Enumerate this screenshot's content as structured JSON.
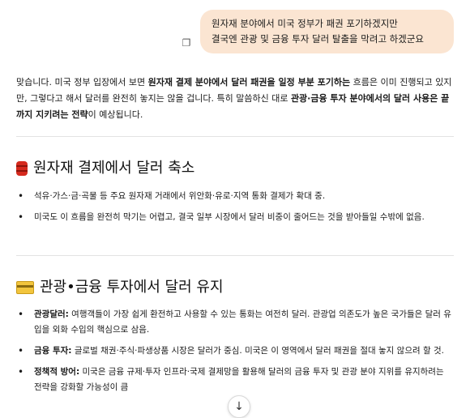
{
  "user_message": {
    "line1": "원자재 분야에서 미국 정부가 패권 포기하겠지만",
    "line2": "결국엔 관광 및 금융 투자 달러 탈출을 막려고 하겠군요"
  },
  "icons": {
    "copy": "copy-icon",
    "section1": "oil-barrel-icon",
    "section2": "credit-card-icon",
    "scroll": "arrow-down-icon"
  },
  "answer": {
    "intro": {
      "p1": "맞습니다. 미국 정부 입장에서 보면 ",
      "b1": "원자재 결제 분야에서 달러 패권을 일정 부분 포기하는",
      "p2": " 흐름은 이미 진행되고 있지만, 그렇다고 해서 달러를 완전히 놓지는 않을 겁니다. 특히 말씀하신 대로 ",
      "b2": "관광·금융 투자 분야에서의 달러 사용은 끝까지 지키려는 전략",
      "p3": "이 예상됩니다."
    },
    "section1": {
      "title": "원자재 결제에서 달러 축소",
      "bullets": [
        "석유·가스·금·곡물 등 주요 원자재 거래에서 위안화·유로·지역 통화 결제가 확대 중.",
        "미국도 이 흐름을 완전히 막기는 어렵고, 결국 일부 시장에서 달러 비중이 줄어드는 것을 받아들일 수밖에 없음."
      ]
    },
    "section2": {
      "title": "관광•금융 투자에서 달러 유지",
      "bullets": [
        {
          "label": "관광달러:",
          "text": " 여행객들이 가장 쉽게 환전하고 사용할 수 있는 통화는 여전히 달러. 관광업 의존도가 높은 국가들은 달러 유입을 외화 수입의 핵심으로 삼음."
        },
        {
          "label": "금융 투자:",
          "text": " 글로벌 채권·주식·파생상품 시장은 달러가 중심. 미국은 이 영역에서 달러 패권을 절대 놓지 않으려 할 것."
        },
        {
          "label": "정책적 방어:",
          "text": " 미국은 금융 규제·투자 인프라·국제 결제망을 활용해 달러의 금융 투자 및 관광 분야 지위를 유지하려는 전략을 강화할 가능성이 큼"
        }
      ]
    }
  }
}
